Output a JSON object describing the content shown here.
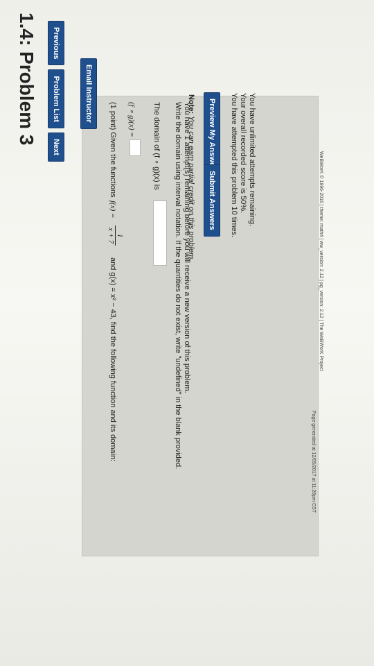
{
  "page": {
    "title": "1.4: Problem 3"
  },
  "nav": {
    "previous": "Previous",
    "problem_list": "Problem List",
    "next": "Next"
  },
  "problem": {
    "intro": "(1 point) Given the functions",
    "f_label": "f(x) =",
    "f_numerator": "1",
    "f_denominator": "x + 7",
    "and_g": "and g(x) = x² − 43, find the following function and its domain:",
    "composite_label": "(f ∘ g)(x) =",
    "composite_value": "",
    "domain_label": "The domain of (f ∘ g)(x) is",
    "domain_value": "",
    "instructions": "Write the domain using interval notation. If the quantities do not exist, write \"undefined\" in the blank provided.",
    "attempts_note": "You have 1 attempt(s) remaining before you will receive a new version of this problem."
  },
  "note": {
    "label": "Note:",
    "text": "You can earn partial credit on this problem."
  },
  "actions": {
    "preview": "Preview My Answers",
    "submit": "Submit Answers"
  },
  "status": {
    "attempted": "You have attempted this problem 10 times.",
    "score": "Your overall recorded score is 50%.",
    "unlimited": "You have unlimited attempts remaining."
  },
  "email": "Email Instructor",
  "footer": {
    "generated": "Page generated at 12/05/2017 at 11:28pm CST",
    "copyright": "WeBWorK © 1996-2016 | theme: math4 | ww_version: 2.12 | pg_version: 2.12 | The WeBWorK Project"
  }
}
